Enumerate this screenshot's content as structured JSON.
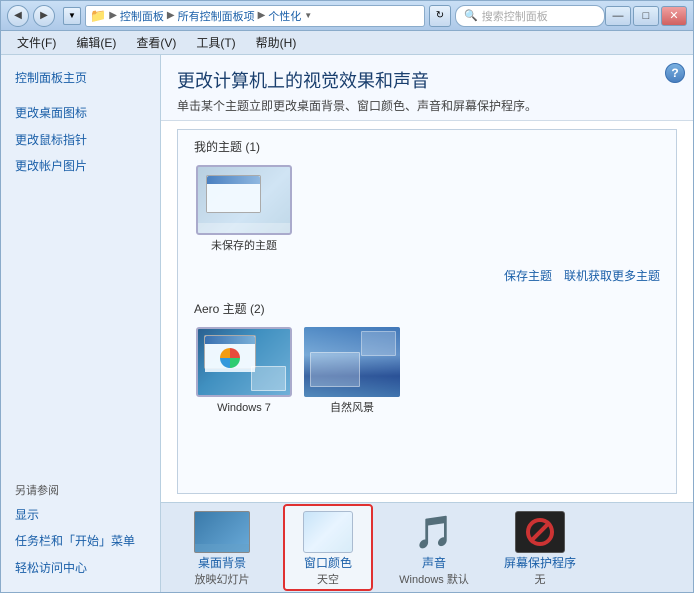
{
  "window": {
    "title": "个性化",
    "controls": {
      "minimize": "—",
      "maximize": "□",
      "close": "✕"
    }
  },
  "titlebar": {
    "back_btn": "◀",
    "forward_btn": "▶",
    "address": {
      "icon": "📁",
      "path": [
        "控制面板",
        "所有控制面板项",
        "个性化"
      ],
      "separators": [
        "▶",
        "▶"
      ]
    },
    "refresh": "↻",
    "search_placeholder": "搜索控制面板",
    "search_icon": "🔍"
  },
  "menubar": {
    "items": [
      "文件(F)",
      "编辑(E)",
      "查看(V)",
      "工具(T)",
      "帮助(H)"
    ]
  },
  "sidebar": {
    "main_link": "控制面板主页",
    "links": [
      "更改桌面图标",
      "更改鼠标指针",
      "更改帐户图片"
    ],
    "also_see_label": "另请参阅",
    "also_see_links": [
      "显示",
      "任务栏和「开始」菜单",
      "轻松访问中心"
    ]
  },
  "content": {
    "title": "更改计算机上的视觉效果和声音",
    "subtitle": "单击某个主题立即更改桌面背景、窗口颜色、声音和屏幕保护程序。",
    "help_btn": "?",
    "my_themes_label": "我的主题 (1)",
    "unsaved_theme_label": "未保存的主题",
    "save_theme_link": "保存主题",
    "online_themes_link": "联机获取更多主题",
    "aero_themes_label": "Aero 主题 (2)",
    "aero_themes": [
      {
        "label": "Windows 7",
        "type": "windows"
      },
      {
        "label": "自然风景",
        "type": "nature"
      }
    ]
  },
  "bottom_bar": {
    "items": [
      {
        "icon": "bg",
        "label": "桌面背景",
        "sublabel": "放映幻灯片"
      },
      {
        "icon": "wc",
        "label": "窗口颜色",
        "sublabel": "天空",
        "highlighted": true
      },
      {
        "icon": "sound",
        "label": "声音",
        "sublabel": "Windows 默认"
      },
      {
        "icon": "ss",
        "label": "屏幕保护程序",
        "sublabel": "无"
      }
    ]
  }
}
